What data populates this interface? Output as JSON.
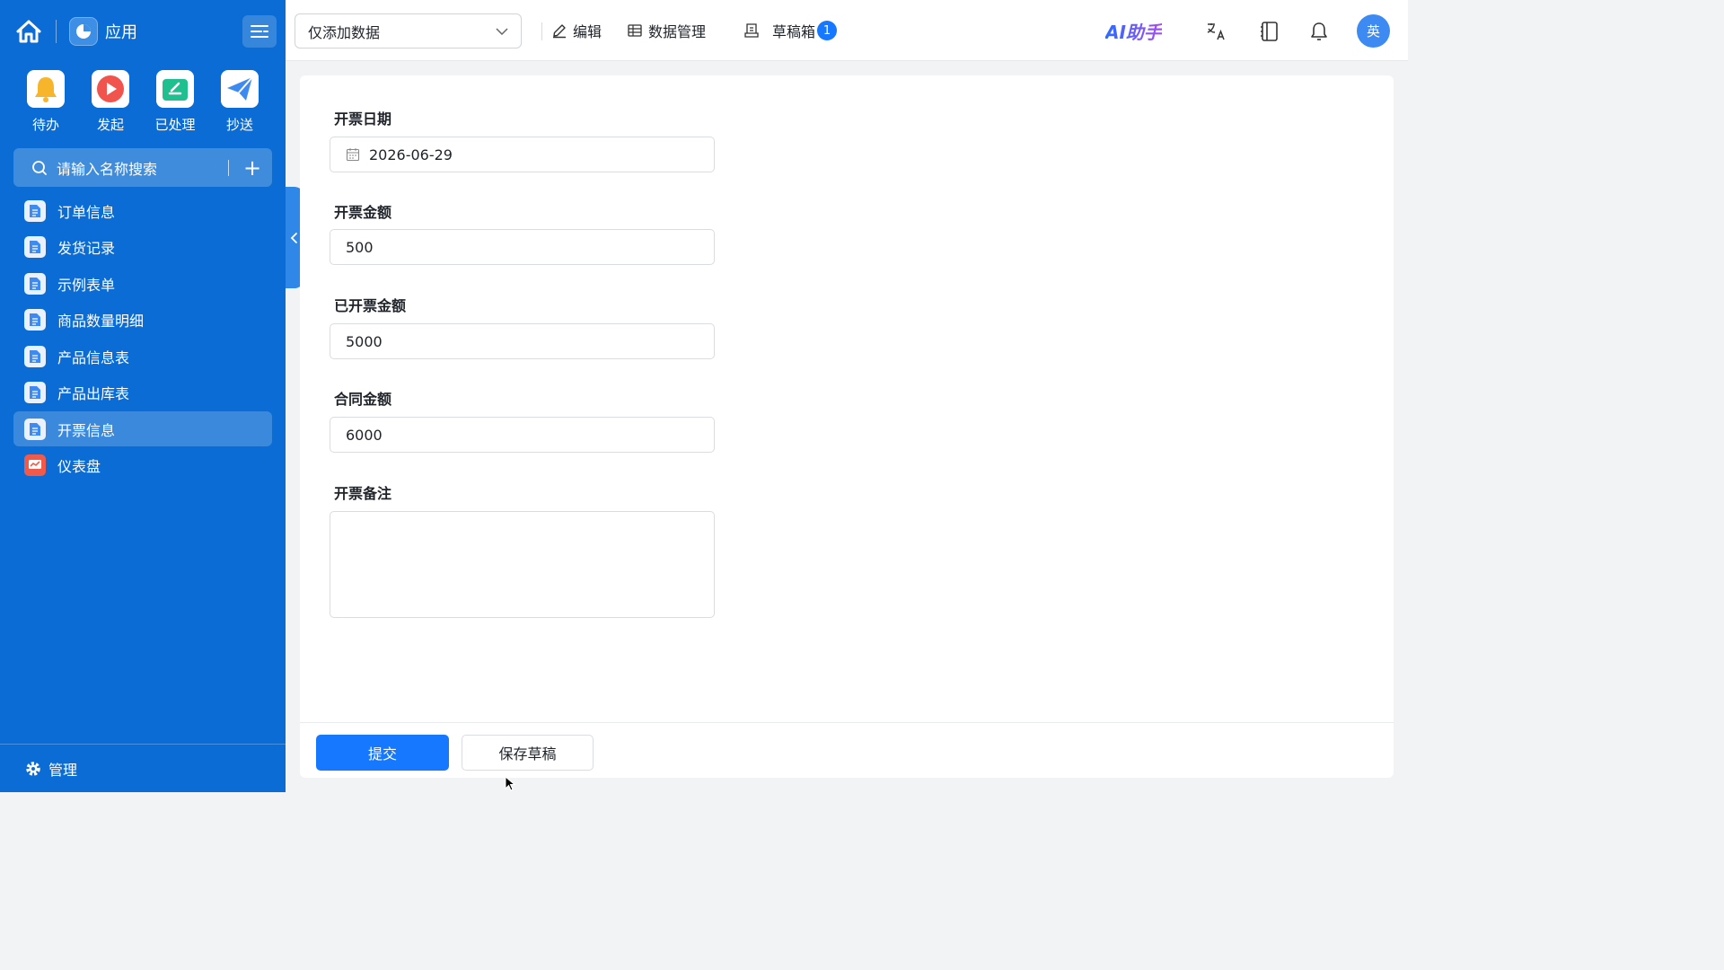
{
  "sidebar": {
    "app_title": "应用",
    "quick_actions": [
      {
        "label": "待办",
        "icon": "bell-icon"
      },
      {
        "label": "发起",
        "icon": "play-icon"
      },
      {
        "label": "已处理",
        "icon": "processed-icon"
      },
      {
        "label": "抄送",
        "icon": "send-icon"
      }
    ],
    "search_placeholder": "请输入名称搜索",
    "nav_items": [
      {
        "label": "订单信息"
      },
      {
        "label": "发货记录"
      },
      {
        "label": "示例表单"
      },
      {
        "label": "商品数量明细"
      },
      {
        "label": "产品信息表"
      },
      {
        "label": "产品出库表"
      },
      {
        "label": "开票信息",
        "active": true
      },
      {
        "label": "仪表盘"
      }
    ],
    "manage_label": "管理"
  },
  "topbar": {
    "select_value": "仅添加数据",
    "edit_label": "编辑",
    "data_manage_label": "数据管理",
    "drafts_label": "草稿箱",
    "drafts_count": "1",
    "ai_label": "AI助手",
    "avatar_text": "英"
  },
  "form": {
    "fields": [
      {
        "label": "开票日期",
        "value": "2026-06-29"
      },
      {
        "label": "开票金额",
        "value": "500"
      },
      {
        "label": "已开票金额",
        "value": "5000"
      },
      {
        "label": "合同金额",
        "value": "6000"
      },
      {
        "label": "开票备注",
        "value": ""
      }
    ],
    "submit_label": "提交",
    "save_draft_label": "保存草稿"
  },
  "colors": {
    "sidebar_bg": "#0a6cd4",
    "primary": "#1677ff"
  }
}
